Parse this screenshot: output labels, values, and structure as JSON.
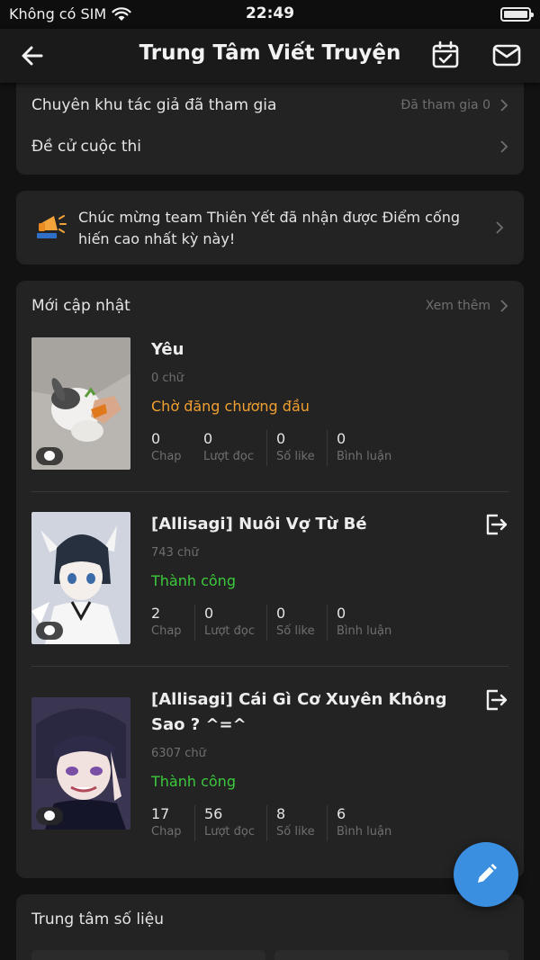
{
  "status_bar": {
    "carrier": "Không có SIM",
    "time": "22:49"
  },
  "nav": {
    "title": "Trung Tâm Viết Truyện"
  },
  "top_card": {
    "rows": [
      {
        "label": "Chuyên khu tác giả đã tham gia",
        "value": "Đã tham gia 0"
      },
      {
        "label": "Đề cử cuộc thi",
        "value": ""
      }
    ]
  },
  "notice": {
    "text": "Chúc mừng team Thiên Yết đã nhận được Điểm cống hiến cao nhất kỳ này!"
  },
  "updates": {
    "title": "Mới cập nhật",
    "more_label": "Xem thêm",
    "stat_labels": {
      "chap": "Chap",
      "reads": "Lượt đọc",
      "likes": "Số like",
      "comments": "Bình luận"
    },
    "stories": [
      {
        "title": "Yêu",
        "words": "0 chữ",
        "status": "Chờ đăng chương đầu",
        "chap": "0",
        "reads": "0",
        "likes": "0",
        "comments": "0"
      },
      {
        "title": "[Allisagi] Nuôi Vợ Từ Bé",
        "words": "743 chữ",
        "status": "Thành công",
        "chap": "2",
        "reads": "0",
        "likes": "0",
        "comments": "0"
      },
      {
        "title": "[Allisagi] Cái Gì Cơ Xuyên Không Sao ? ^=^",
        "words": "6307 chữ",
        "status": "Thành công",
        "chap": "17",
        "reads": "56",
        "likes": "8",
        "comments": "6"
      }
    ]
  },
  "data_center": {
    "title": "Trung tâm số liệu"
  },
  "colors": {
    "pending": "#f0a030",
    "success": "#3cc93c",
    "fab": "#3a8fe0",
    "background": "#121212",
    "card": "#232323"
  },
  "icons": [
    "back-arrow-icon",
    "calendar-check-icon",
    "mail-icon",
    "chevron-right-icon",
    "megaphone-icon",
    "comment-icon",
    "exit-icon",
    "pencil-icon",
    "wifi-icon",
    "battery-icon"
  ]
}
